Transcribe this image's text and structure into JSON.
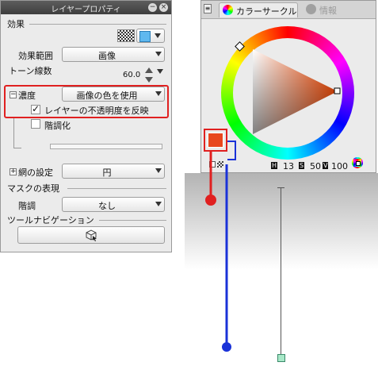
{
  "layer_property": {
    "title": "レイヤープロパティ",
    "effect_section": "効果",
    "effect_range_label": "効果範囲",
    "effect_range_value": "画像",
    "tone_lines_label": "トーン線数",
    "tone_lines_value": "60.0",
    "density_label": "濃度",
    "density_value": "画像の色を使用",
    "reflect_opacity_label": "レイヤーの不透明度を反映",
    "posterize_label": "階調化",
    "halftone_label": "網の設定",
    "halftone_value": "円",
    "mask_section": "マスクの表現",
    "gradation_label": "階調",
    "gradation_value": "なし",
    "tool_nav_section": "ツールナビゲーション"
  },
  "color_circle": {
    "tab_color_circle": "カラーサークル",
    "tab_info": "情報",
    "h_value": "13",
    "s_value": "50",
    "v_value": "100",
    "h_letter": "H",
    "s_letter": "S",
    "v_letter": "V",
    "current_color": "#e8471e"
  },
  "colors": {
    "highlight_red": "#e02020",
    "annotation_blue": "#1a32d8",
    "annotation_red": "#e02020"
  }
}
